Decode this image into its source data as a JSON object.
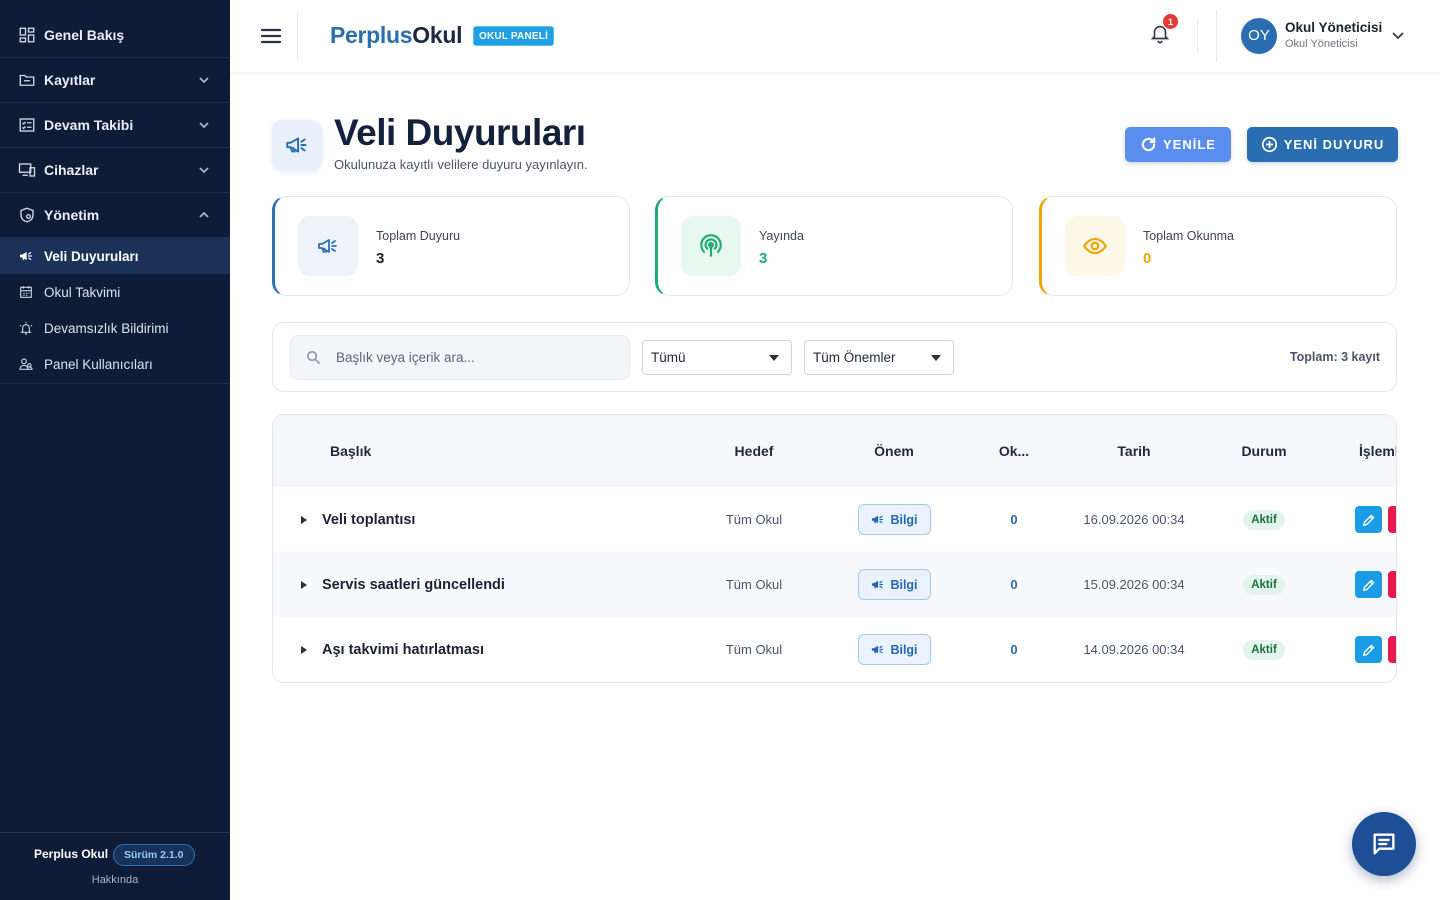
{
  "sidebar": {
    "menu": [
      {
        "label": "Genel Bakış",
        "icon": "dashboard-icon"
      },
      {
        "label": "Kayıtlar",
        "icon": "folder-icon",
        "expanded": false
      },
      {
        "label": "Devam Takibi",
        "icon": "checklist-icon",
        "expanded": false
      },
      {
        "label": "Cihazlar",
        "icon": "devices-icon",
        "expanded": false
      },
      {
        "label": "Yönetim",
        "icon": "shield-icon",
        "expanded": true
      }
    ],
    "submenu": [
      {
        "label": "Veli Duyuruları",
        "icon": "megaphone-icon",
        "active": true
      },
      {
        "label": "Okul Takvimi",
        "icon": "calendar-icon"
      },
      {
        "label": "Devamsızlık Bildirimi",
        "icon": "alarm-icon"
      },
      {
        "label": "Panel Kullanıcıları",
        "icon": "users-icon"
      }
    ],
    "footer": {
      "brand": "Perplus Okul",
      "version": "Sürüm 2.1.0",
      "about": "Hakkında"
    }
  },
  "header": {
    "brand_primary": "Perplus",
    "brand_secondary": "Okul",
    "badge": "OKUL PANELİ",
    "notification_count": "1",
    "user": {
      "initials": "OY",
      "name": "Okul Yöneticisi",
      "role": "Okul Yöneticisi"
    }
  },
  "page": {
    "title": "Veli Duyuruları",
    "subtitle": "Okulunuza kayıtlı velilere duyuru yayınlayın.",
    "buttons": {
      "refresh": "YENİLE",
      "new": "YENİ DUYURU"
    }
  },
  "stats": [
    {
      "label": "Toplam Duyuru",
      "value": "3",
      "color": "#2f6fb5",
      "icon": "megaphone-icon"
    },
    {
      "label": "Yayında",
      "value": "3",
      "color": "#1fae72",
      "icon": "broadcast-icon"
    },
    {
      "label": "Toplam Okunma",
      "value": "0",
      "color": "#f0a500",
      "icon": "eye-icon"
    }
  ],
  "filters": {
    "search_placeholder": "Başlık veya içerik ara...",
    "target": "Tümü",
    "priority": "Tüm Önemler",
    "total": "Toplam: 3 kayıt"
  },
  "table": {
    "columns": [
      "Başlık",
      "Hedef",
      "Önem",
      "Ok...",
      "Tarih",
      "Durum",
      "İşlemler"
    ],
    "rows": [
      {
        "title": "Veli toplantısı",
        "target": "Tüm Okul",
        "priority": "Bilgi",
        "reads": "0",
        "date": "16.09.2026 00:34",
        "status": "Aktif"
      },
      {
        "title": "Servis saatleri güncellendi",
        "target": "Tüm Okul",
        "priority": "Bilgi",
        "reads": "0",
        "date": "15.09.2026 00:34",
        "status": "Aktif"
      },
      {
        "title": "Aşı takvimi hatırlatması",
        "target": "Tüm Okul",
        "priority": "Bilgi",
        "reads": "0",
        "date": "14.09.2026 00:34",
        "status": "Aktif"
      }
    ]
  },
  "colors": {
    "sidebar_bg": "#0f1c37",
    "primary": "#2a6db0",
    "accent_light": "#5b8def",
    "success": "#1fae72",
    "warning": "#f0a500",
    "danger": "#e8194d",
    "edit": "#1c9be6"
  }
}
